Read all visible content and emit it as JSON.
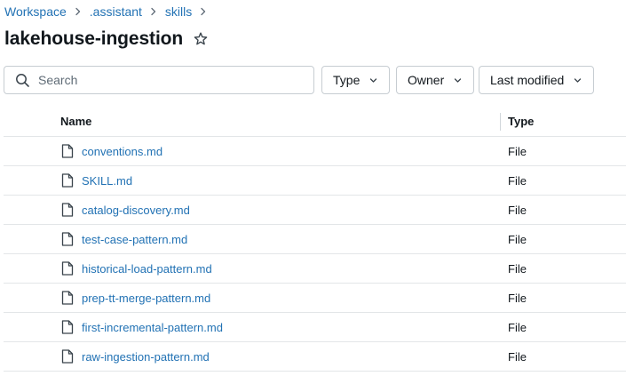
{
  "breadcrumb": {
    "items": [
      "Workspace",
      ".assistant",
      "skills"
    ]
  },
  "page": {
    "title": "lakehouse-ingestion"
  },
  "search": {
    "placeholder": "Search",
    "value": ""
  },
  "filters": {
    "type_label": "Type",
    "owner_label": "Owner",
    "modified_label": "Last modified"
  },
  "table": {
    "columns": [
      "Name",
      "Type"
    ],
    "rows": [
      {
        "name": "conventions.md",
        "type": "File"
      },
      {
        "name": "SKILL.md",
        "type": "File"
      },
      {
        "name": "catalog-discovery.md",
        "type": "File"
      },
      {
        "name": "test-case-pattern.md",
        "type": "File"
      },
      {
        "name": "historical-load-pattern.md",
        "type": "File"
      },
      {
        "name": "prep-tt-merge-pattern.md",
        "type": "File"
      },
      {
        "name": "first-incremental-pattern.md",
        "type": "File"
      },
      {
        "name": "raw-ingestion-pattern.md",
        "type": "File"
      }
    ]
  },
  "icons": {
    "breadcrumb_separator": "chevron-right-icon",
    "favorite": "star-icon",
    "search": "search-icon",
    "dropdown": "chevron-down-icon",
    "file": "file-icon"
  },
  "colors": {
    "link": "#2272b4",
    "text": "#11171c",
    "border": "#c7cdd2",
    "row_divider": "#e3e6e8"
  }
}
